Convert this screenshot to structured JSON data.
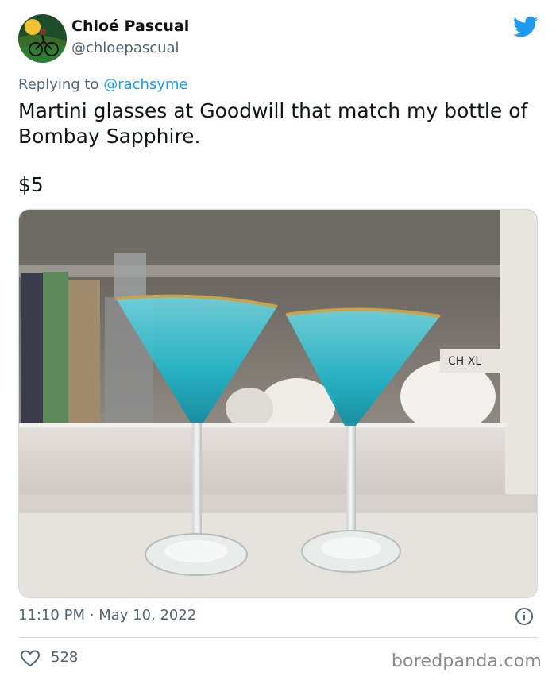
{
  "author": {
    "name": "Chloé Pascual",
    "handle": "@chloepascual",
    "avatar_icon": "cyclist-avatar"
  },
  "reply": {
    "prefix": "Replying to",
    "mention": "@rachsyme"
  },
  "tweet": {
    "text": "Martini glasses at Goodwill that match my bottle of Bombay Sapphire.",
    "price": "$5",
    "image_description_icon": "martini-glasses-photo"
  },
  "meta": {
    "time": "11:10 PM",
    "separator": "·",
    "date": "May 10, 2022"
  },
  "engagement": {
    "likes": "528"
  },
  "watermark": "boredpanda.com",
  "colors": {
    "twitter_blue": "#1d9bf0",
    "muted_text": "#536471",
    "main_text": "#0f1419",
    "glass_teal": "#1fb5c9",
    "gold_rim": "#c9a34a"
  }
}
